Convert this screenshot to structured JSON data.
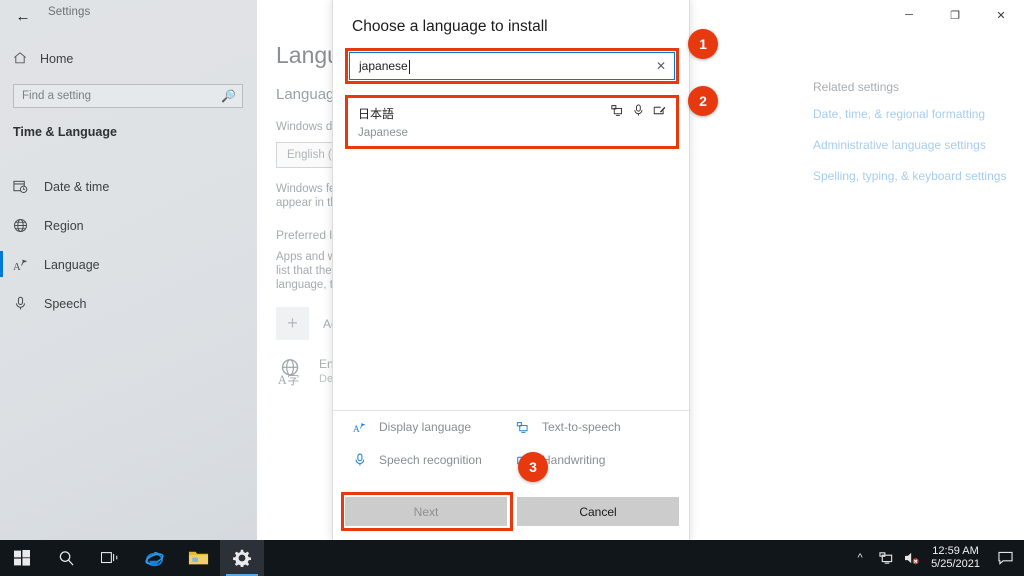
{
  "window": {
    "app_title": "Settings",
    "back_icon": "back-arrow-icon",
    "controls": {
      "minimize": "─",
      "maximize": "❐",
      "close": "✕"
    }
  },
  "sidebar": {
    "home_label": "Home",
    "search": {
      "placeholder": "Find a setting",
      "icon": "search-icon"
    },
    "section_header": "Time & Language",
    "items": [
      {
        "label": "Date & time",
        "icon": "calendar-clock-icon",
        "selected": false
      },
      {
        "label": "Region",
        "icon": "globe-icon",
        "selected": false
      },
      {
        "label": "Language",
        "icon": "language-icon",
        "selected": true
      },
      {
        "label": "Speech",
        "icon": "microphone-icon",
        "selected": false
      }
    ]
  },
  "main": {
    "page_title": "Language",
    "sub_title": "Language",
    "windows_display_text": "Windows display language",
    "display_language_value": "English (United States)",
    "windows_features_text": "Windows features like Settings and File Explorer will appear in this language.",
    "preferred_header": "Preferred languages",
    "preferred_text": "Apps and websites will appear in the first language in the list that they support. Press and hold (or select) a language, then drag to rearrange them.",
    "add_language_label": "Add a language",
    "add_language_icon": "plus-icon",
    "installed_language_name": "English (United States)",
    "installed_language_sub": "Default app language, Windows display language",
    "installed_language_icon": "language-pack-icon"
  },
  "related": {
    "header": "Related settings",
    "links": [
      "Date, time, & regional formatting",
      "Administrative language settings",
      "Spelling, typing, & keyboard settings"
    ]
  },
  "dialog": {
    "title": "Choose a language to install",
    "search": {
      "value": "japanese",
      "clear_icon": "close-icon"
    },
    "result": {
      "native_name": "日本語",
      "english_name": "Japanese",
      "icons": [
        "text-to-speech-icon",
        "speech-recognition-icon",
        "handwriting-icon"
      ]
    },
    "features": [
      {
        "label": "Display language",
        "icon": "display-language-icon"
      },
      {
        "label": "Text-to-speech",
        "icon": "text-to-speech-icon"
      },
      {
        "label": "Speech recognition",
        "icon": "microphone-icon"
      },
      {
        "label": "Handwriting",
        "icon": "handwriting-icon"
      }
    ],
    "buttons": {
      "next": "Next",
      "cancel": "Cancel"
    }
  },
  "annotations": {
    "accent_color": "#e8380d",
    "badges": [
      "1",
      "2",
      "3"
    ]
  },
  "taskbar": {
    "items": [
      {
        "name": "start-button",
        "icon": "windows-logo-icon"
      },
      {
        "name": "search-button",
        "icon": "search-icon"
      },
      {
        "name": "task-view-button",
        "icon": "task-view-icon"
      },
      {
        "name": "internet-explorer-button",
        "icon": "internet-explorer-icon"
      },
      {
        "name": "file-explorer-button",
        "icon": "folder-icon"
      },
      {
        "name": "settings-button",
        "icon": "gear-icon"
      }
    ],
    "tray": {
      "show_hidden_icon": "chevron-up-icon",
      "network_icon": "network-icon",
      "volume_icon": "volume-muted-icon",
      "time": "12:59 AM",
      "date": "5/25/2021",
      "action_center_icon": "speech-bubble-icon"
    }
  }
}
